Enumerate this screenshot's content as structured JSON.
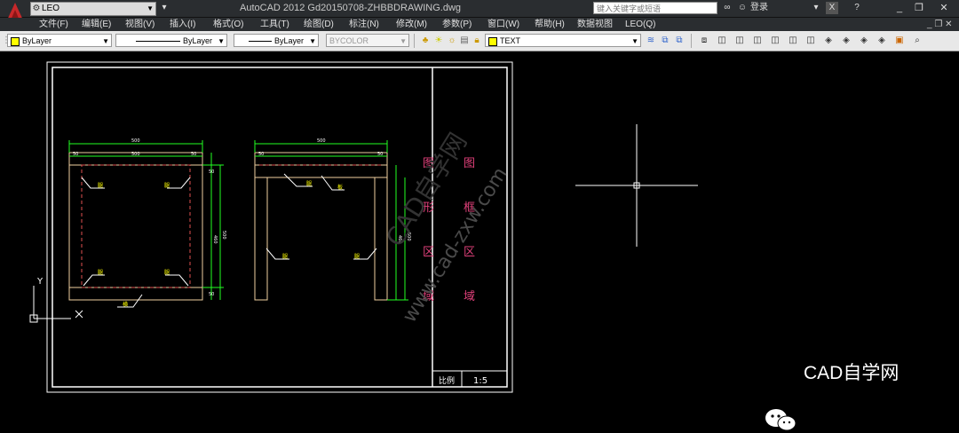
{
  "app": {
    "title": "AutoCAD 2012   Gd20150708-ZHBBDRAWING.dwg",
    "workspace": "LEO",
    "search_placeholder": "键入关键字或短语",
    "sign_in": "登录"
  },
  "menu": [
    "文件(F)",
    "编辑(E)",
    "视图(V)",
    "插入(I)",
    "格式(O)",
    "工具(T)",
    "绘图(D)",
    "标注(N)",
    "修改(M)",
    "参数(P)",
    "窗口(W)",
    "帮助(H)",
    "数据视图",
    "LEO(Q)"
  ],
  "toolbar": {
    "layer_color": "ByLayer",
    "linetype": "ByLayer",
    "lineweight": "ByLayer",
    "plotstyle": "BYCOLOR",
    "text_style": "TEXT"
  },
  "drawing": {
    "front_view": {
      "top_dim": "500",
      "inner_dim": "500",
      "side_dims": [
        "50",
        "50"
      ],
      "right_dims": [
        "50",
        "50"
      ],
      "height_dims": [
        "500",
        "460"
      ],
      "labels": [
        "腿",
        "腿",
        "腿",
        "腿",
        "横"
      ]
    },
    "side_view": {
      "top_dim": "500",
      "side_dims": [
        "50",
        "50"
      ],
      "height_dims": [
        "500",
        "460"
      ],
      "labels": [
        "腿",
        "板",
        "腿",
        "腿"
      ]
    },
    "vertical_text_left": [
      "图",
      "形",
      "区",
      "域"
    ],
    "vertical_text_right": [
      "图",
      "框",
      "区",
      "域"
    ],
    "title_block": {
      "label": "比例",
      "scale": "1:5"
    },
    "watermark": "www.cad-zxw.com",
    "ucs": {
      "x": "X",
      "y": "Y"
    }
  },
  "watermark_brand": "CAD自学网"
}
